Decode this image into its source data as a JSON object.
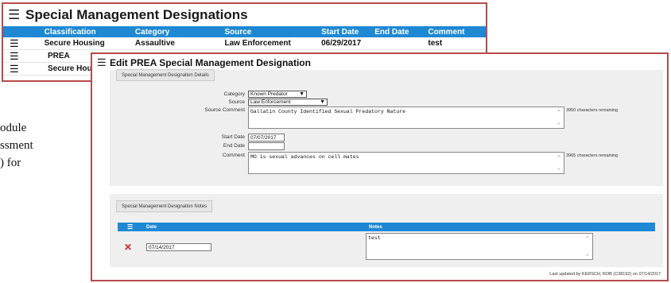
{
  "background_doc": {
    "lines": [
      "odule",
      "ssment",
      ") for"
    ]
  },
  "designations": {
    "title": "Special Management Designations",
    "columns": [
      "Classification",
      "Category",
      "Source",
      "Start Date",
      "End Date",
      "Comment"
    ],
    "rows": [
      {
        "classification": "Secure Housing",
        "category": "Assaultive",
        "source": "Law Enforcement",
        "start": "06/29/2017",
        "end": "",
        "comment": "test"
      },
      {
        "classification": "PREA",
        "category": "",
        "source": "",
        "start": "",
        "end": "",
        "comment": ""
      },
      {
        "classification": "Secure Hou",
        "category": "",
        "source": "",
        "start": "",
        "end": "",
        "comment": ""
      }
    ]
  },
  "edit": {
    "title": "Edit PREA Special Management Designation",
    "details_tab": "Special Management Designation Details",
    "labels": {
      "category": "Category",
      "source": "Source",
      "source_comment": "Source Comment",
      "start_date": "Start Date",
      "end_date": "End Date",
      "comment": "Comment"
    },
    "category_value": "Known Predator",
    "source_value": "Law Enforcement",
    "source_comment_value": "Gallatin County Identified Sexual Predatory Nature",
    "source_comment_remaining": "3950 characters remaining",
    "start_date_value": "07/07/2017",
    "end_date_value": "",
    "comment_value": "MO is sexual advances on cell mates",
    "comment_remaining": "3965 characters remaining",
    "notes_tab": "Special Management Designation Notes",
    "notes_columns": {
      "date": "Date",
      "notes": "Notes"
    },
    "note_row": {
      "date": "07/14/2017",
      "notes": "test"
    },
    "footer": "Last updated by KERSCH, ROB (C38192) on 07/14/2017"
  },
  "icons": {
    "menu": "hamburger-menu-icon",
    "dropdown": "triangle-down-icon",
    "delete": "red-x-delete-icon"
  },
  "colors": {
    "accent": "#1e88d4",
    "highlight_border": "#b94a4a",
    "delete": "#d32222"
  }
}
